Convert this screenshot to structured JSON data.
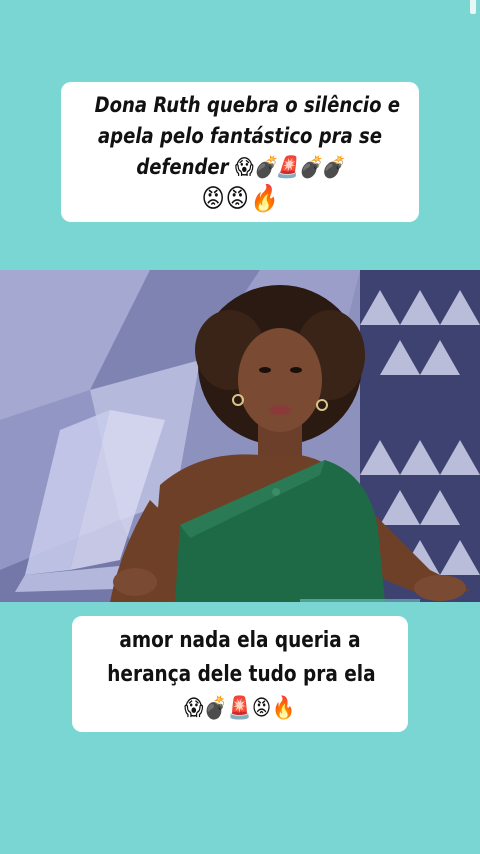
{
  "top_caption": {
    "line1": "Dona Ruth quebra o silêncio e",
    "line2": "apela pelo fantástico pra se",
    "line3": "defender 😱💣🚨💣💣",
    "line4": "😡😡🔥"
  },
  "bottom_caption": {
    "line1": "amor nada ela queria a",
    "line2": "herança dele tudo pra ela",
    "line3": "😱💣🚨😡🔥"
  },
  "video": {
    "subject": "woman-presenter",
    "colors": {
      "background": "#79d6d3",
      "dress": "#1f6a46",
      "set_wall": "#8b8fb8"
    }
  }
}
